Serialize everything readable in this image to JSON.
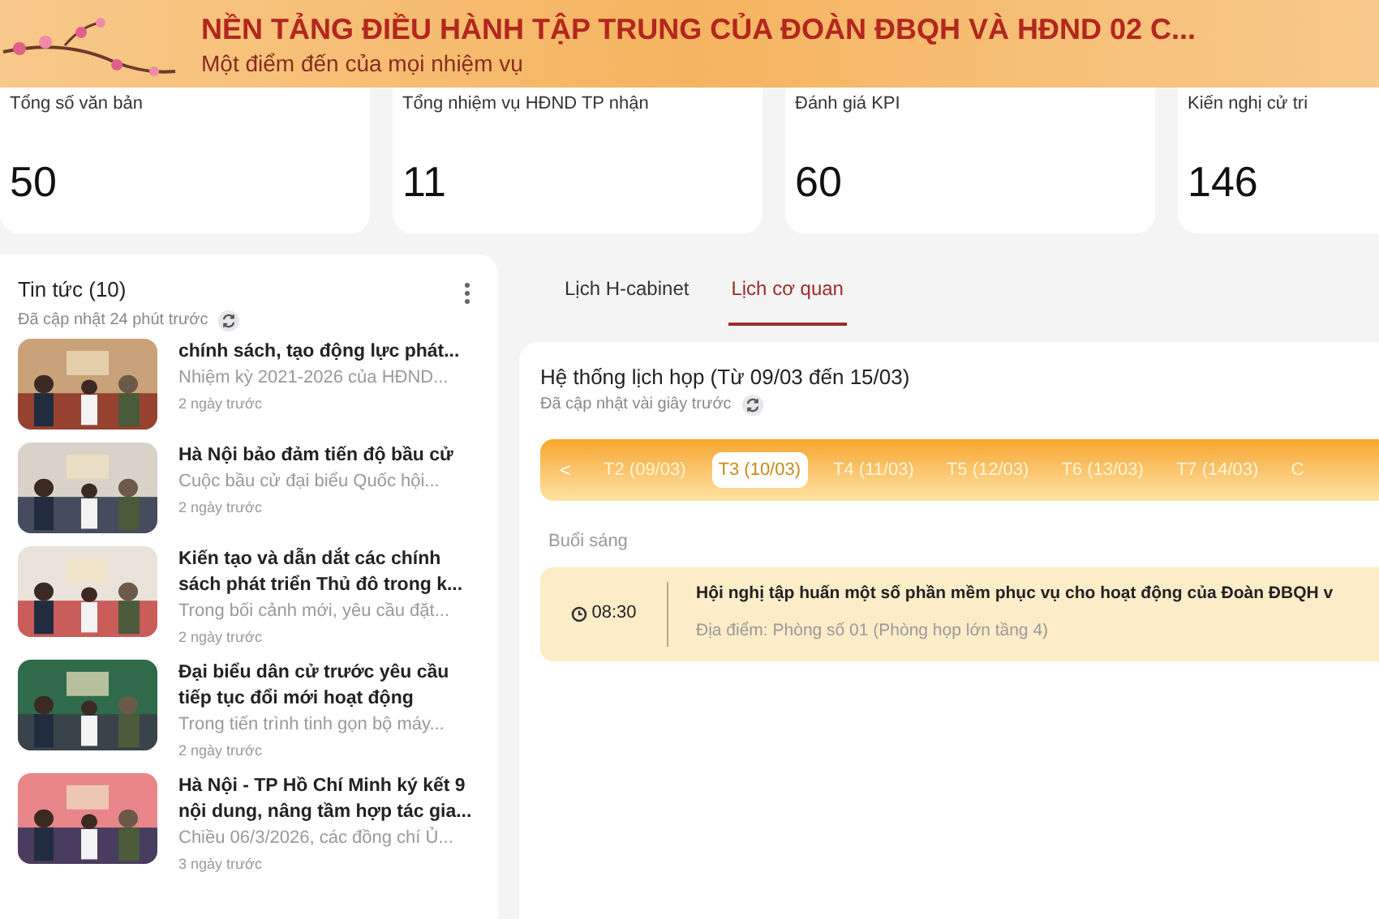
{
  "header": {
    "title": "NỀN TẢNG ĐIỀU HÀNH TẬP TRUNG CỦA ĐOÀN ĐBQH VÀ HĐND 02 C...",
    "subtitle": "Một điểm đến của mọi nhiệm vụ"
  },
  "stats": [
    {
      "label": "Tổng số văn bản",
      "value": "50"
    },
    {
      "label": "Tổng nhiệm vụ HĐND TP nhận",
      "value": "11"
    },
    {
      "label": "Đánh giá KPI",
      "value": "60"
    },
    {
      "label": "Kiến nghị cử tri",
      "value": "146"
    }
  ],
  "news": {
    "title": "Tin tức (10)",
    "updated": "Đã cập nhật 24 phút trước",
    "items": [
      {
        "title": "chính sách, tạo động lực phát...",
        "summary": "Nhiệm kỳ 2021-2026 của HĐND...",
        "time": "2 ngày trước"
      },
      {
        "title": "Hà Nội bảo đảm tiến độ bầu cử",
        "summary": "Cuộc bầu cử đại biểu Quốc hội...",
        "time": "2 ngày trước"
      },
      {
        "title": "Kiến tạo và dẫn dắt các chính sách phát triển Thủ đô trong k...",
        "summary": "Trong bối cảnh mới, yêu cầu đặt...",
        "time": "2 ngày trước"
      },
      {
        "title": "Đại biểu dân cử trước yêu cầu tiếp tục đổi mới hoạt động",
        "summary": "Trong tiến trình tinh gọn bộ máy...",
        "time": "2 ngày trước"
      },
      {
        "title": "Hà Nội - TP Hồ Chí Minh ký kết 9 nội dung, nâng tầm hợp tác gia...",
        "summary": "Chiều 06/3/2026, các đồng chí Ủ...",
        "time": "3 ngày trước"
      }
    ]
  },
  "tabs": [
    {
      "label": "Lịch H-cabinet",
      "selected": false
    },
    {
      "label": "Lịch cơ quan",
      "selected": true
    }
  ],
  "schedule": {
    "title": "Hệ thống lịch họp (Từ 09/03 đến 15/03)",
    "updated": "Đã cập nhật vài giây trước",
    "prev": "<",
    "days": [
      {
        "label": "T2 (09/03)",
        "selected": false
      },
      {
        "label": "T3 (10/03)",
        "selected": true
      },
      {
        "label": "T4 (11/03)",
        "selected": false
      },
      {
        "label": "T5 (12/03)",
        "selected": false
      },
      {
        "label": "T6 (13/03)",
        "selected": false
      },
      {
        "label": "T7 (14/03)",
        "selected": false
      },
      {
        "label": "C",
        "selected": false
      }
    ],
    "section": "Buổi sáng",
    "events": [
      {
        "time": "08:30",
        "title": "Hội nghị tập huấn một số phần mềm phục vụ cho hoạt động của Đoàn ĐBQH v",
        "location": "Địa điểm: Phòng số 01 (Phòng họp lớn tầng 4)"
      }
    ]
  }
}
